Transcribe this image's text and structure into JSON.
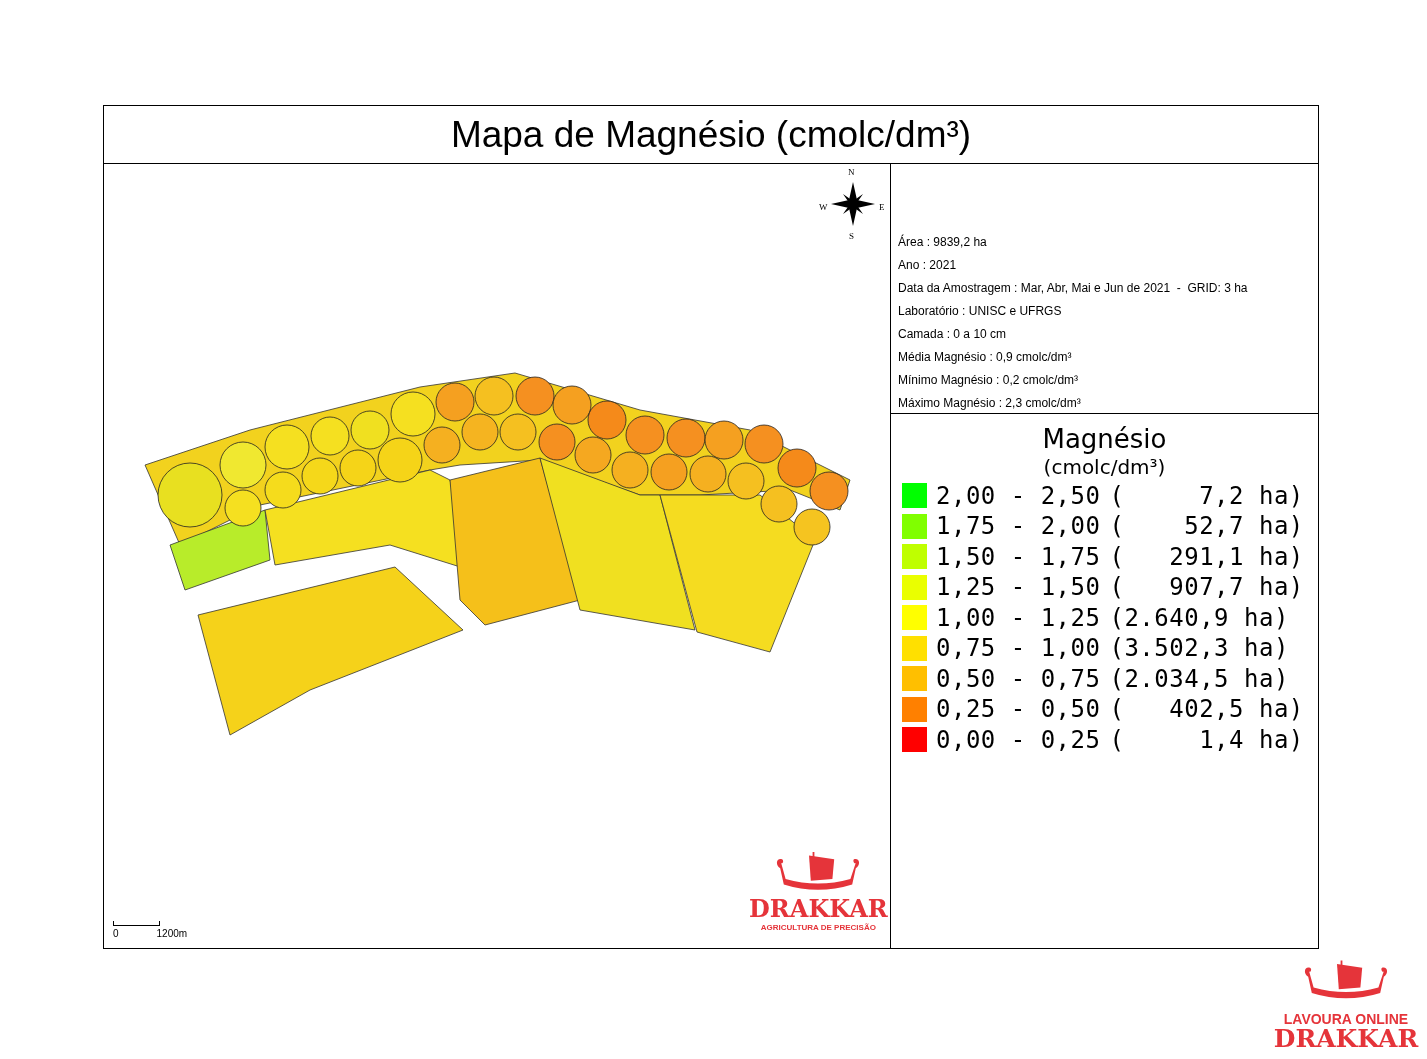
{
  "title": "Mapa de Magnésio (cmolc/dm³)",
  "compass": {
    "north": "N",
    "west": "W",
    "east": "E",
    "south": "S"
  },
  "scale_bar": {
    "start": "0",
    "end": "1200m"
  },
  "map_logo": {
    "name": "DRAKKAR",
    "tagline": "AGRICULTURA DE PRECISÃO"
  },
  "info": [
    "Área : 9839,2 ha",
    "Ano : 2021",
    "Data da Amostragem : Mar, Abr, Mai e Jun de 2021  -  GRID: 3 ha",
    "Laboratório : UNISC e UFRGS",
    "Camada : 0 a 10 cm",
    "Média Magnésio : 0,9 cmolc/dm³",
    "Mínimo Magnésio : 0,2 cmolc/dm³",
    "Máximo Magnésio : 2,3 cmolc/dm³"
  ],
  "legend": {
    "title": "Magnésio",
    "unit": "(cmolc/dm³)",
    "items": [
      {
        "color": "#00ff00",
        "range": "2,00 - 2,50",
        "area": "(     7,2 ha)"
      },
      {
        "color": "#80ff00",
        "range": "1,75 - 2,00",
        "area": "(    52,7 ha)"
      },
      {
        "color": "#bfff00",
        "range": "1,50 - 1,75",
        "area": "(   291,1 ha)"
      },
      {
        "color": "#eaff00",
        "range": "1,25 - 1,50",
        "area": "(   907,7 ha)"
      },
      {
        "color": "#ffff00",
        "range": "1,00 - 1,25",
        "area": "(2.640,9 ha)"
      },
      {
        "color": "#ffe000",
        "range": "0,75 - 1,00",
        "area": "(3.502,3 ha)"
      },
      {
        "color": "#ffbf00",
        "range": "0,50 - 0,75",
        "area": "(2.034,5 ha)"
      },
      {
        "color": "#ff8000",
        "range": "0,25 - 0,50",
        "area": "(   402,5 ha)"
      },
      {
        "color": "#ff0000",
        "range": "0,00 - 0,25",
        "area": "(     1,4 ha)"
      }
    ]
  },
  "brand": {
    "line1": "LAVOURA ONLINE",
    "line2": "DRAKKAR"
  }
}
